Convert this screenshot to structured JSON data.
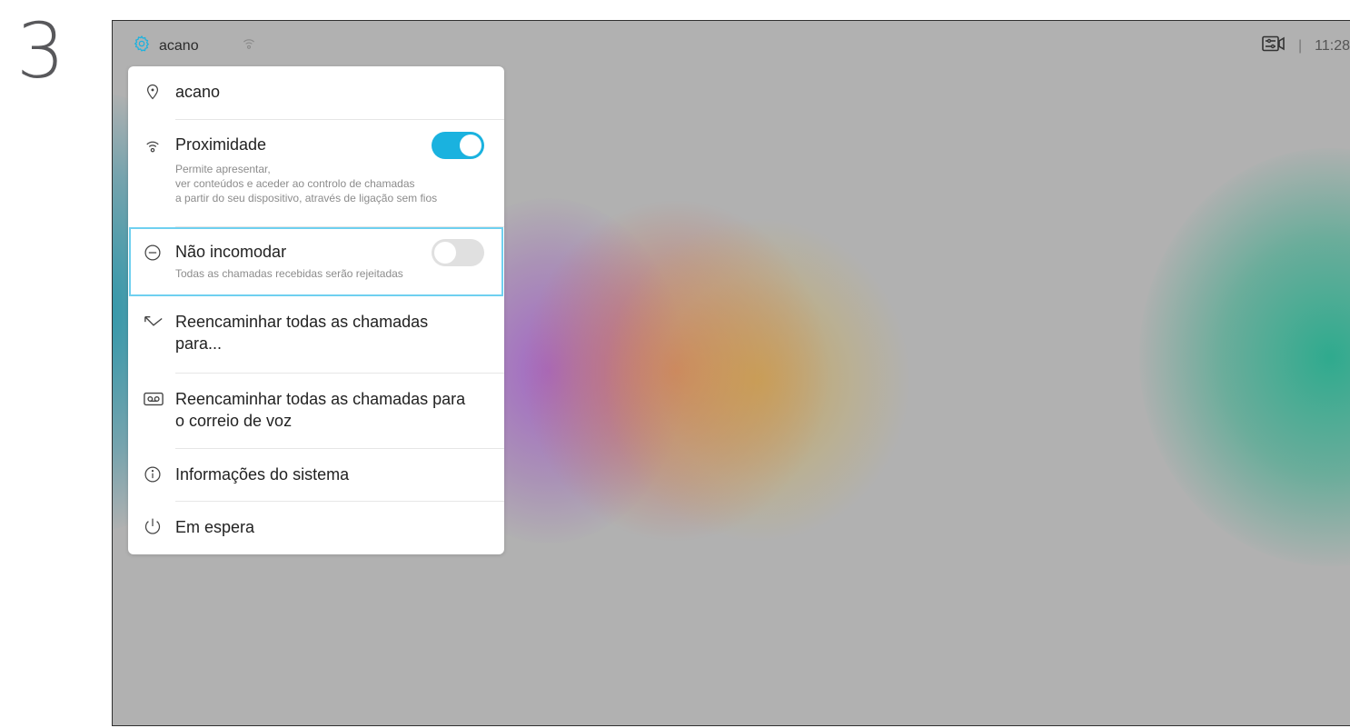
{
  "step": {
    "number": "3"
  },
  "statusbar": {
    "device_name": "acano",
    "time": "11:28",
    "separator": "|",
    "accent_color": "#1ab2df"
  },
  "menu": {
    "location": {
      "label": "acano",
      "icon": "location-pin-icon"
    },
    "proximity": {
      "label": "Proximidade",
      "desc_line1": "Permite apresentar,",
      "desc_line2": "ver conteúdos e aceder ao controlo de chamadas",
      "desc_line3": "a partir do seu dispositivo, através de ligação sem fios",
      "toggle_on": true,
      "icon": "proximity-icon"
    },
    "dnd": {
      "label": "Não incomodar",
      "desc": "Todas as chamadas recebidas serão rejeitadas",
      "toggle_on": false,
      "icon": "minus-circle-icon"
    },
    "forward": {
      "label_line1": "Reencaminhar todas as chamadas",
      "label_line2": "para...",
      "icon": "forward-arrow-icon"
    },
    "voicemail": {
      "label_line1": "Reencaminhar todas as chamadas para",
      "label_line2": "o correio de voz",
      "icon": "voicemail-icon"
    },
    "sysinfo": {
      "label": "Informações do sistema",
      "icon": "info-icon"
    },
    "standby": {
      "label": "Em espera",
      "icon": "power-icon"
    }
  }
}
